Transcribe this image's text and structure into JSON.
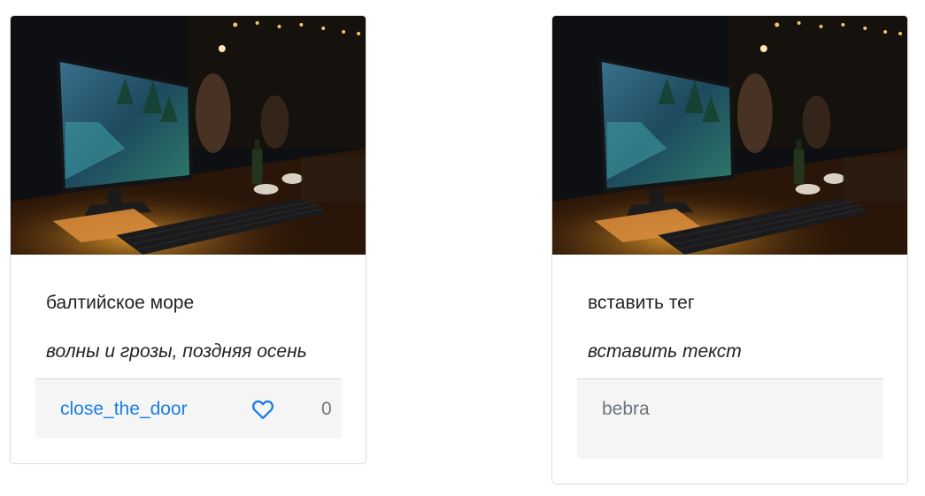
{
  "cards": [
    {
      "image": "desk-computer-night-photo",
      "title": "балтийское море",
      "text": "волны и грозы, поздняя осень",
      "author": "close_the_door",
      "like_icon": "heart-outline-icon",
      "likes": "0",
      "link_color": "#1a7ee6"
    },
    {
      "image": "desk-computer-night-photo",
      "title": "вставить тег",
      "text": "вставить текст",
      "author": "bebra"
    }
  ]
}
